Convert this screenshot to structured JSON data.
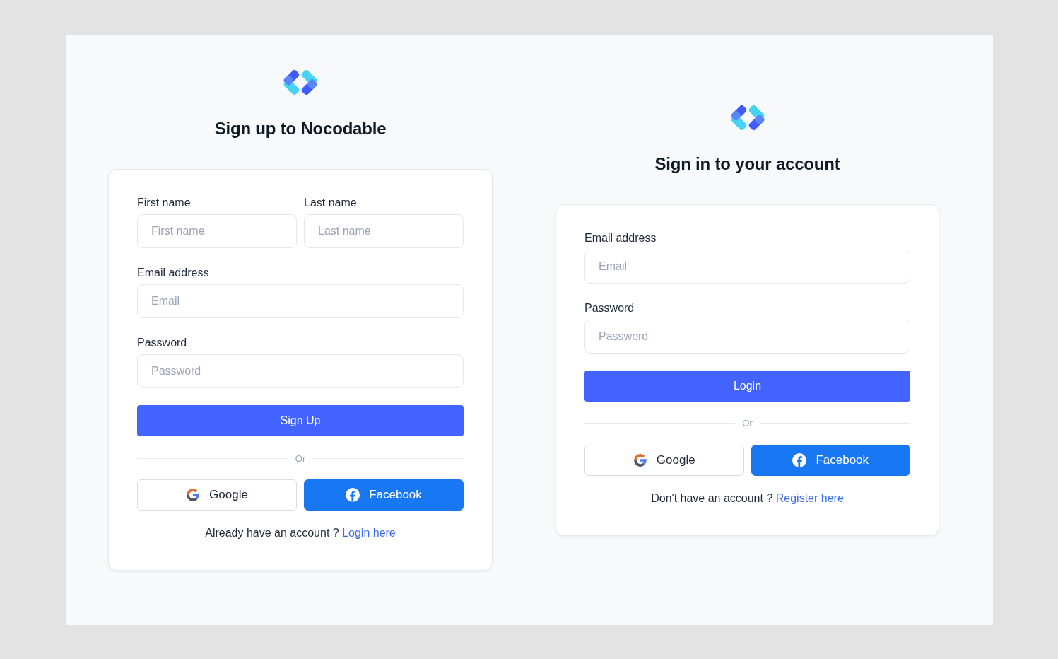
{
  "forms": [
    {
      "title": "Sign up to Nocodable",
      "rows": [
        [
          {
            "label": "First name",
            "placeholder": "First name"
          },
          {
            "label": "Last name",
            "placeholder": "Last name"
          }
        ],
        [
          {
            "label": "Email address",
            "placeholder": "Email"
          }
        ],
        [
          {
            "label": "Password",
            "placeholder": "Password"
          }
        ]
      ],
      "submit": "Sign Up",
      "divider": "Or",
      "social_buttons": [
        {
          "kind": "google",
          "label": "Google"
        },
        {
          "kind": "facebook",
          "label": "Facebook"
        }
      ],
      "footer": {
        "text": "Already have an account ?",
        "link": "Login here"
      }
    },
    {
      "title": "Sign in to your account",
      "rows": [
        [
          {
            "label": "Email address",
            "placeholder": "Email"
          }
        ],
        [
          {
            "label": "Password",
            "placeholder": "Password"
          }
        ]
      ],
      "submit": "Login",
      "divider": "Or",
      "social_buttons": [
        {
          "kind": "google",
          "label": "Google"
        },
        {
          "kind": "facebook",
          "label": "Facebook"
        }
      ],
      "footer": {
        "text": "Don't have an account ?",
        "link": "Register here"
      }
    }
  ]
}
